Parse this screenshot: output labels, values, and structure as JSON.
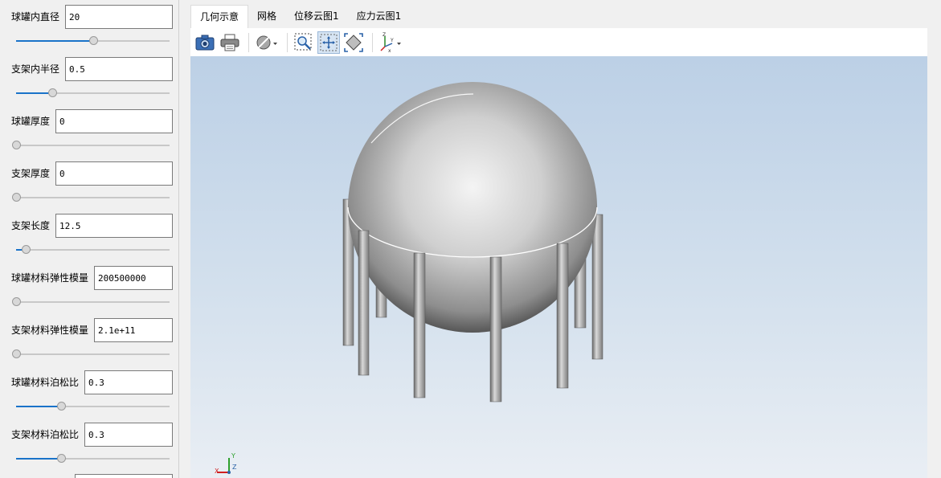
{
  "parameters": [
    {
      "label": "球罐内直径",
      "value": "20",
      "slider_fraction": 0.5
    },
    {
      "label": "支架内半径",
      "value": "0.5",
      "slider_fraction": 0.23
    },
    {
      "label": "球罐厚度",
      "value": "0",
      "slider_fraction": 0.0
    },
    {
      "label": "支架厚度",
      "value": "0",
      "slider_fraction": 0.0
    },
    {
      "label": "支架长度",
      "value": "12.5",
      "slider_fraction": 0.06
    },
    {
      "label": "球罐材料弹性模量",
      "value": "200500000",
      "slider_fraction": 0.0
    },
    {
      "label": "支架材料弹性模量",
      "value": "2.1e+11",
      "slider_fraction": 0.0
    },
    {
      "label": "球罐材料泊松比",
      "value": "0.3",
      "slider_fraction": 0.29
    },
    {
      "label": "支架材料泊松比",
      "value": "0.3",
      "slider_fraction": 0.29
    }
  ],
  "tabs": [
    {
      "label": "几何示意",
      "active": true
    },
    {
      "label": "网格",
      "active": false
    },
    {
      "label": "位移云图1",
      "active": false
    },
    {
      "label": "应力云图1",
      "active": false
    }
  ],
  "toolbar": {
    "icons": [
      "camera-icon",
      "print-icon",
      "display-mode-icon",
      "zoom-box-icon",
      "fit-view-icon",
      "rotate-view-icon",
      "axes-orientation-icon"
    ]
  },
  "viewport": {
    "axis_labels": {
      "x": "X",
      "y": "Y",
      "z": "Z"
    }
  },
  "colors": {
    "slider_accent": "#1a73c9",
    "panel_bg": "#f0f0f0",
    "viewport_top": "#bcd0e6",
    "viewport_bottom": "#e9eef4"
  }
}
